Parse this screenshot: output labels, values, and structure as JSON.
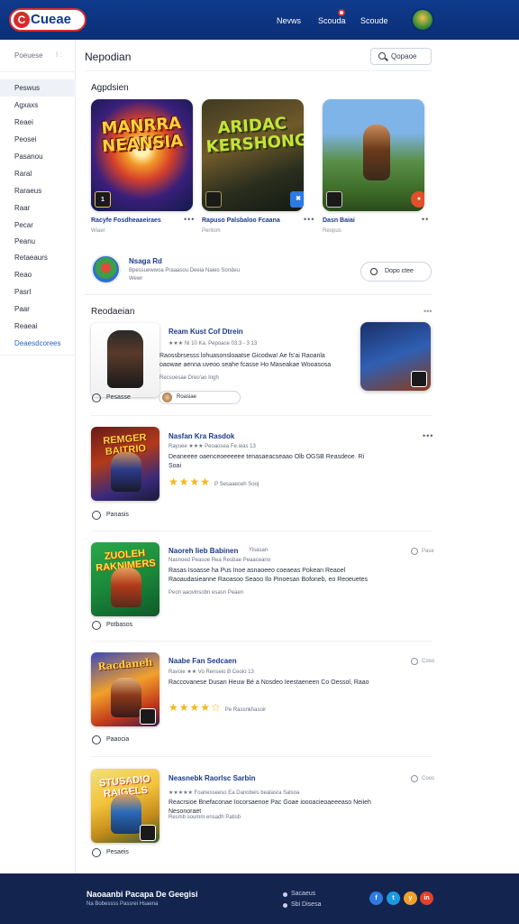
{
  "header": {
    "logo": "Cueae",
    "nav": [
      "Nevws",
      "Scouda",
      "Scoude"
    ],
    "colors": {
      "bar": "#0f3a8c",
      "accent": "#d62b2b"
    }
  },
  "sidebar": {
    "top_label": "Poeuese",
    "top_mark": "I :",
    "items": [
      "Peswus",
      "Agxaxs",
      "Reaei",
      "Peosei",
      "Pasanou",
      "Raral",
      "Raraeus",
      "Raar",
      "Pecar",
      "Peanu",
      "Retaeaurs",
      "Reao",
      "Pasrl",
      "Paar",
      "Reaeai"
    ],
    "link": "Deaesdcorees"
  },
  "main": {
    "title": "Nepodian",
    "search_placeholder": "Qopaoe"
  },
  "featured": {
    "heading": "Agpdsien",
    "cards": [
      {
        "art_title": "MANRRA NEANSIA",
        "badge": "1",
        "name": "Racyfe Fosdheaaeiraes",
        "sub": "Wiaer"
      },
      {
        "art_title": "ARIDAC KERSHONG",
        "badge": "✖",
        "name": "Rapuso Palsbaloo Fcaana",
        "sub": "Pentom"
      },
      {
        "art_title": "",
        "badge": "●",
        "name": "Dasn Baiai",
        "sub": "Reopus"
      }
    ]
  },
  "promo": {
    "title": "Nsaga Rd",
    "desc": "Bpessuewwoa Praaasou Deeia Naieo Sondeu",
    "desc2": "Wewr",
    "button": "Dopo ctee"
  },
  "recommend": {
    "heading": "Reodaeian",
    "more": "•••",
    "rows": [
      {
        "title": "Ream Kust Cof Dtrein",
        "meta": "★★★ Ni 10 Ka. Pepoace 03.3 - 3 13",
        "desc": "Raossbrsesss lohuasonsloaatse Gicodwa! Ae fs'ai Raoanla oaowae aenna uveoo seahe fcasse Ho Maseakae Wooasosa",
        "foot": "Recsoesae Dreo'ao Ingh",
        "action": "Pesasse",
        "chip": "Roasiae"
      },
      {
        "title": "Nasfan Kra Rasdok",
        "meta": "Rayuee ★★★ Peoaosea Fe.ieas 13",
        "desc": "Deaneeee oaenceoeeeeee tenasaeacseaao Olb OGSB Reasdeoe. Ri Soai",
        "rating_label": "P Sesaaeceh Sooj",
        "action": "Panasis",
        "art_title": "REMGER BAITRIO"
      },
      {
        "title": "Naoreh Iieb Babinen",
        "side_tag": "Yisasan",
        "meta": "Nasnoed Peasoe Rea Resbae Peaaceano",
        "desc": "Rasas Isoasse ha Pus Inoe asnaoeeo coeaeas Pokean Reaoel Raoaudasieanne Raoasoo Seaoo Ilo Pinoesan Bofoneb, eo Reoeuetes",
        "foot": "Peon aaovinsobn esasn Peaen",
        "action": "Potbasos",
        "side": "Pase",
        "art_title": "ZUOLEH RAKNIMERS"
      },
      {
        "title": "Naabe Fan Sedcaen",
        "meta": "Ravoie ★★ Vo Renseio B Ceoio 13",
        "desc": "Raccovanese Dusan Heuw Bé a Nosdeo Ieestaeneen Co Oessol, Raao",
        "rating_label": "Pe Rassnkhasoir",
        "action": "Paaocia",
        "side": "Coso",
        "art_title": "Racdaneh"
      },
      {
        "title": "Neasnebk Raorlsc Sarbin",
        "meta": "★★★★★ Foanesseeso Ea Danobeis bealasra Salsoa",
        "desc": "Reacrsioe Bnefaconae Iocorsaenoe Pac Goae ioooacieoaeeeaso Neiieh Nesonoraet",
        "foot": "Resmb soumm ensadh Patisb",
        "action": "Pesaeis",
        "side": "Coos",
        "art_title": "STUSADIO RAIGELS"
      }
    ]
  },
  "footer": {
    "brand": "Naoaanbi Pacapa De Geegisi",
    "sub": "Na Bobessss Passrei Hsaena",
    "links": [
      "Sacaeus",
      "Sbi Disesa"
    ],
    "social": [
      "f",
      "t",
      "y",
      "in"
    ]
  }
}
